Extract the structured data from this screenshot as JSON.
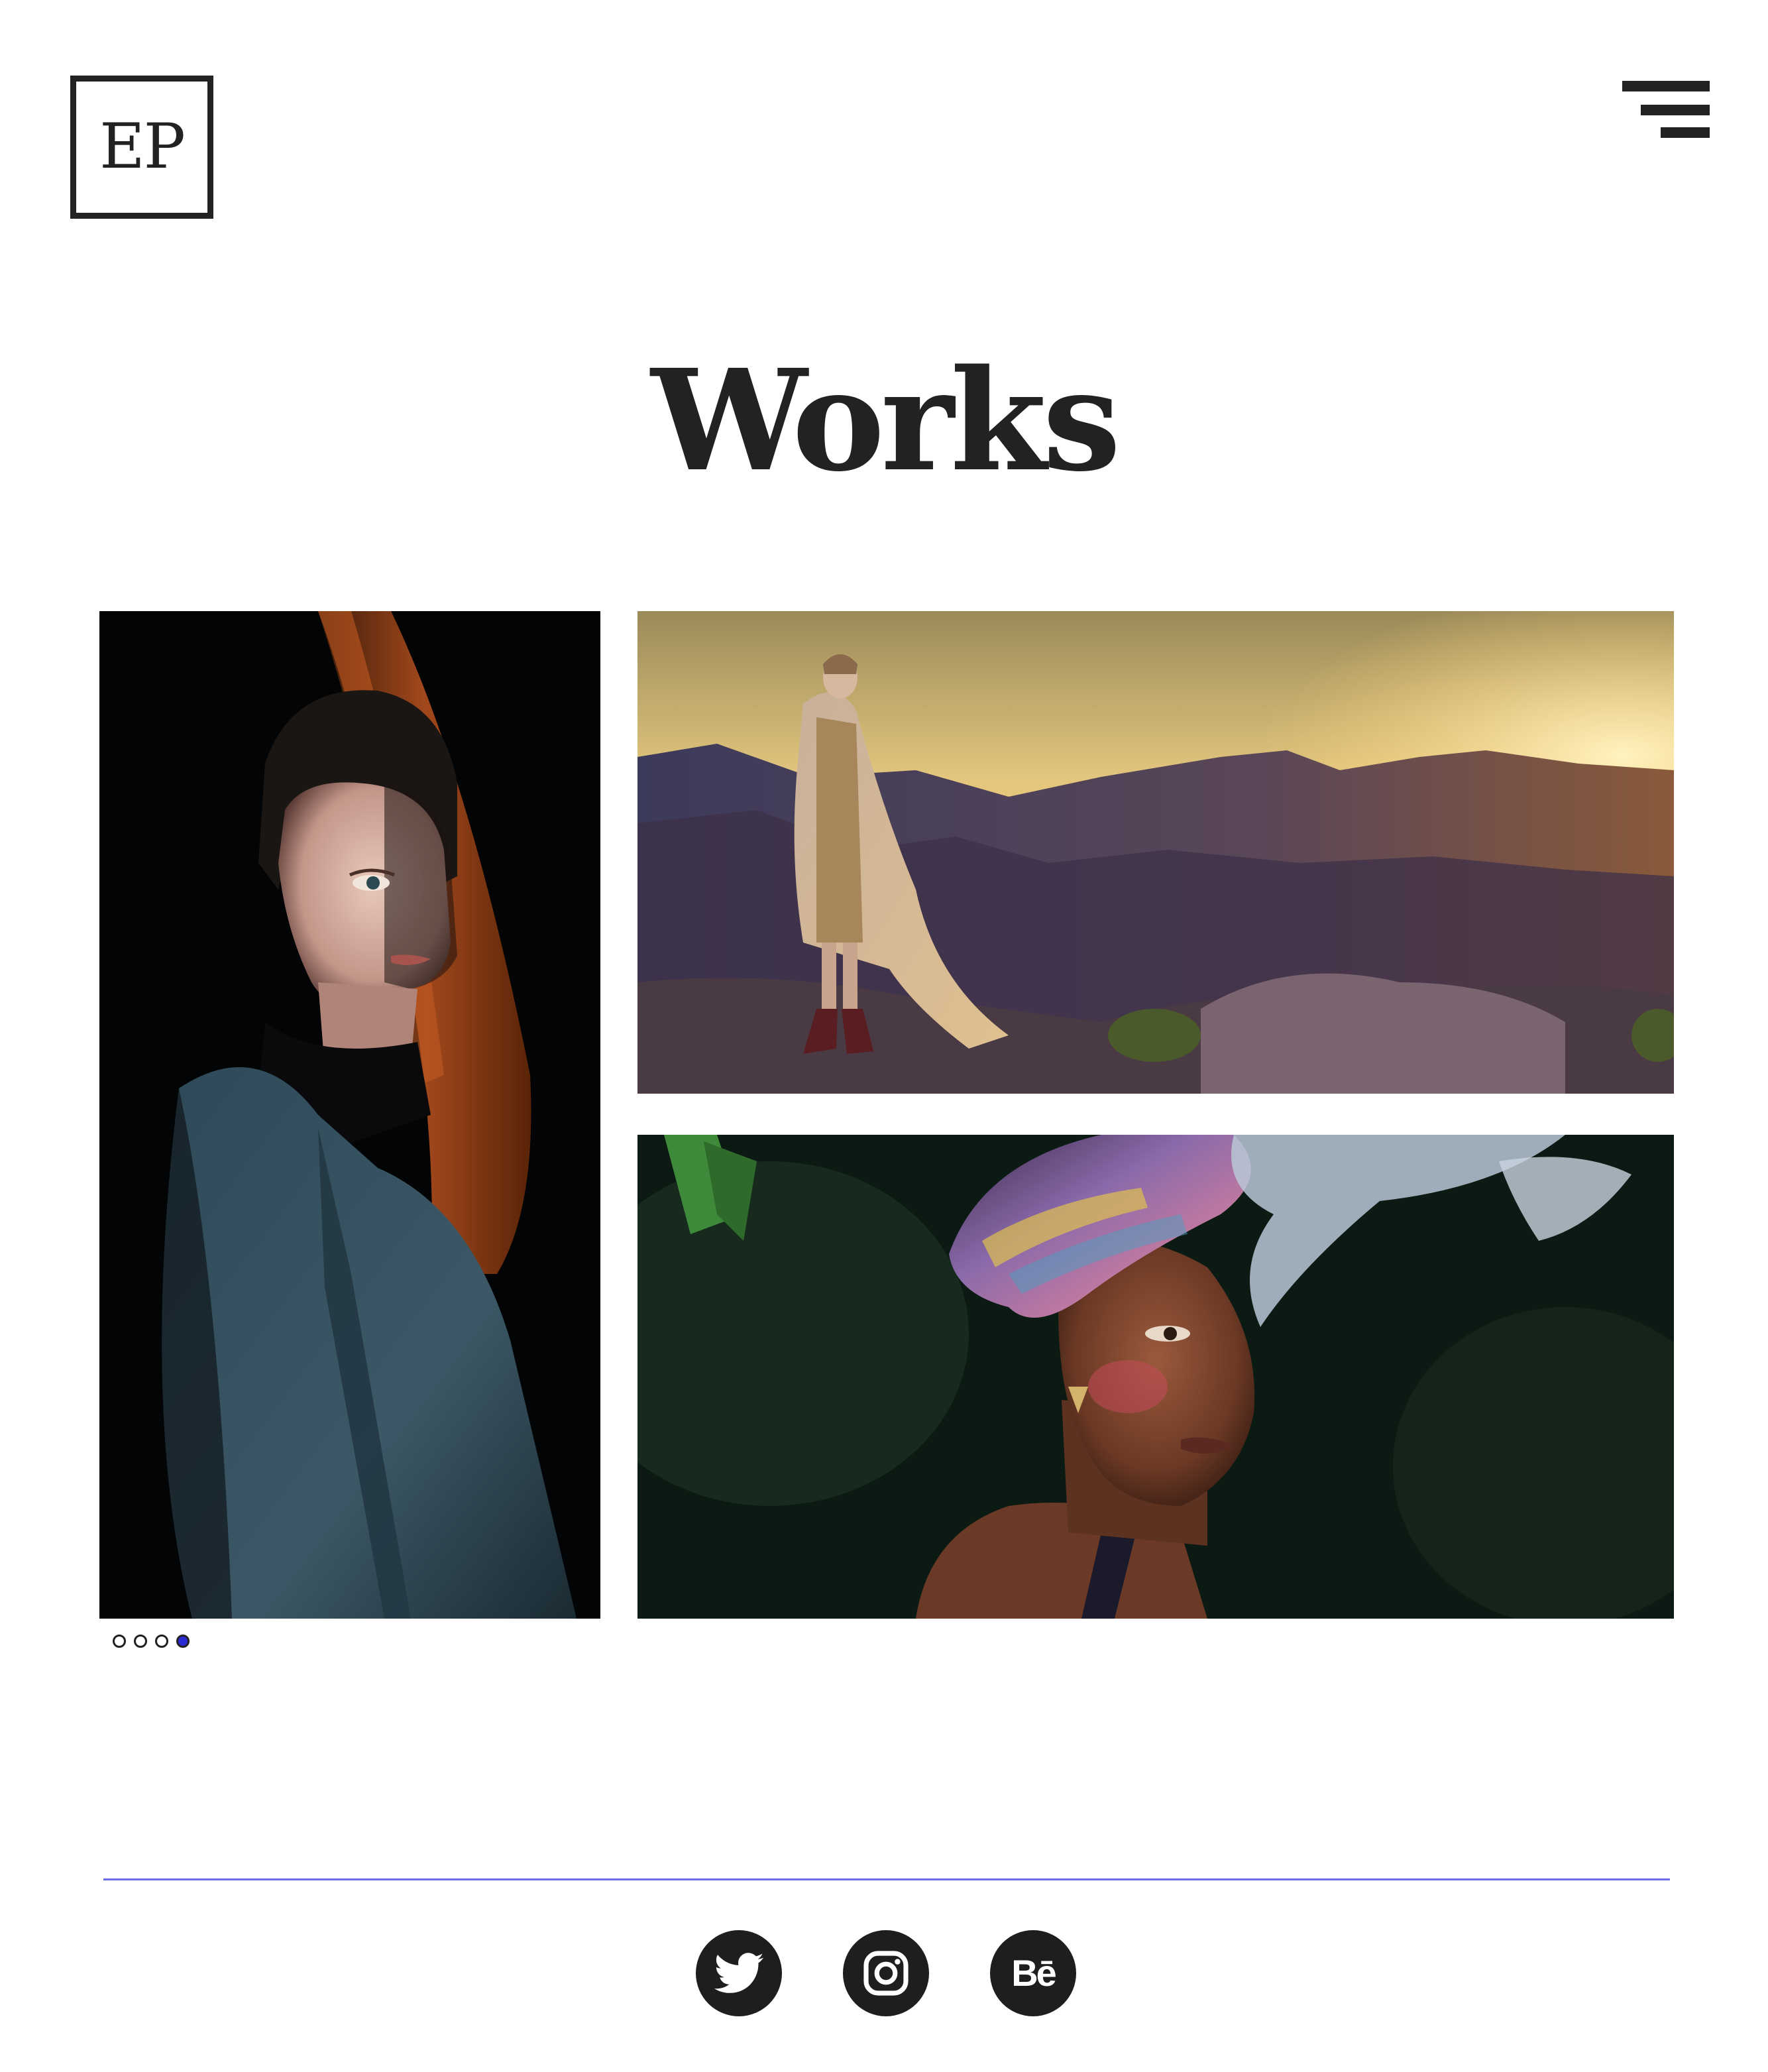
{
  "logo": {
    "text": "EP"
  },
  "header": {
    "menu_icon": "hamburger-menu-icon"
  },
  "page": {
    "title": "Works"
  },
  "gallery": {
    "photos": [
      {
        "subject": "portrait-woman-in-grey-coat"
      },
      {
        "subject": "woman-with-cape-on-canyon-at-sunset"
      },
      {
        "subject": "woman-with-headwrap-closeup"
      }
    ],
    "carousel": {
      "total": 4,
      "active_index": 4
    }
  },
  "social": {
    "links": [
      {
        "icon": "twitter-icon"
      },
      {
        "icon": "instagram-icon"
      },
      {
        "icon": "behance-icon",
        "label": "Bē"
      }
    ]
  },
  "colors": {
    "text": "#222222",
    "accent": "#2b2bd6",
    "divider": "#6c6ce8",
    "social_bg": "#1e1e1e"
  }
}
